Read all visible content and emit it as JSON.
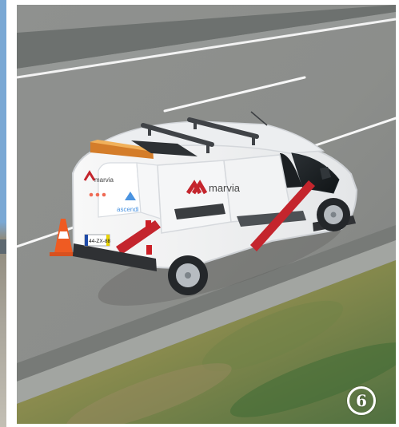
{
  "photo": {
    "badge": {
      "number": "6"
    },
    "van": {
      "brand_side": "marvia",
      "brand_rear": "marvia",
      "partner_logo": "ascendi",
      "plate": "44-ZX-88"
    },
    "colors": {
      "asphalt": "#8d8f8d",
      "van_body": "#f1f2f3",
      "stripe_red": "#c4252d",
      "cone_orange": "#ef5b22",
      "roof_bars": "#404347",
      "beacon": "#d47d2a"
    },
    "icons": [
      "traffic-cone-icon",
      "van-image",
      "number-badge-icon"
    ]
  }
}
